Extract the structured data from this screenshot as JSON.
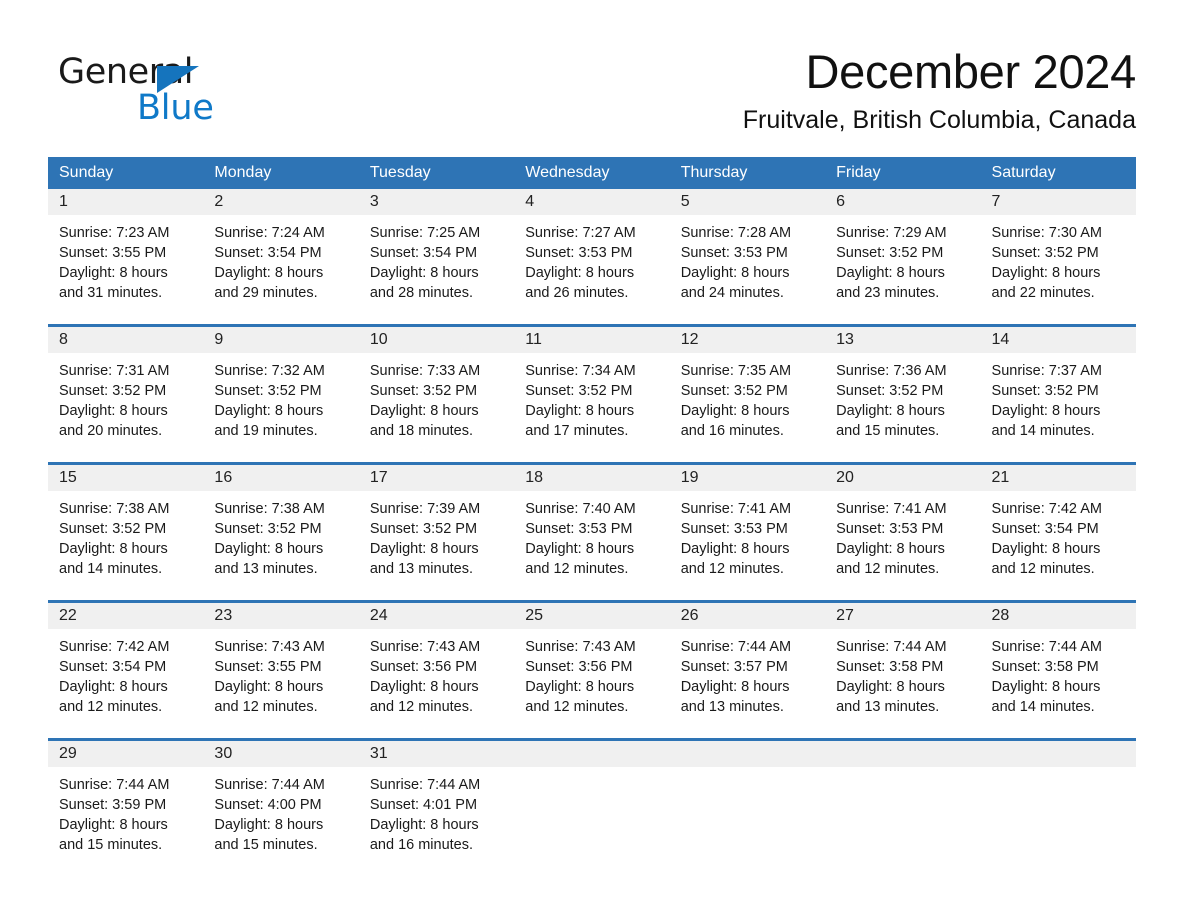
{
  "brand": {
    "name_part1": "General",
    "name_part2": "Blue",
    "logo_icon": "triangle-flag-icon",
    "accent_color": "#0f79c8"
  },
  "header": {
    "month_title": "December 2024",
    "location": "Fruitvale, British Columbia, Canada"
  },
  "theme": {
    "header_blue": "#2e74b5",
    "daynum_band": "#f0f0f0",
    "text": "#1a1a1a"
  },
  "weekdays": [
    "Sunday",
    "Monday",
    "Tuesday",
    "Wednesday",
    "Thursday",
    "Friday",
    "Saturday"
  ],
  "weeks": [
    [
      {
        "day": "1",
        "sunrise": "Sunrise: 7:23 AM",
        "sunset": "Sunset: 3:55 PM",
        "daylight_1": "Daylight: 8 hours",
        "daylight_2": "and 31 minutes."
      },
      {
        "day": "2",
        "sunrise": "Sunrise: 7:24 AM",
        "sunset": "Sunset: 3:54 PM",
        "daylight_1": "Daylight: 8 hours",
        "daylight_2": "and 29 minutes."
      },
      {
        "day": "3",
        "sunrise": "Sunrise: 7:25 AM",
        "sunset": "Sunset: 3:54 PM",
        "daylight_1": "Daylight: 8 hours",
        "daylight_2": "and 28 minutes."
      },
      {
        "day": "4",
        "sunrise": "Sunrise: 7:27 AM",
        "sunset": "Sunset: 3:53 PM",
        "daylight_1": "Daylight: 8 hours",
        "daylight_2": "and 26 minutes."
      },
      {
        "day": "5",
        "sunrise": "Sunrise: 7:28 AM",
        "sunset": "Sunset: 3:53 PM",
        "daylight_1": "Daylight: 8 hours",
        "daylight_2": "and 24 minutes."
      },
      {
        "day": "6",
        "sunrise": "Sunrise: 7:29 AM",
        "sunset": "Sunset: 3:52 PM",
        "daylight_1": "Daylight: 8 hours",
        "daylight_2": "and 23 minutes."
      },
      {
        "day": "7",
        "sunrise": "Sunrise: 7:30 AM",
        "sunset": "Sunset: 3:52 PM",
        "daylight_1": "Daylight: 8 hours",
        "daylight_2": "and 22 minutes."
      }
    ],
    [
      {
        "day": "8",
        "sunrise": "Sunrise: 7:31 AM",
        "sunset": "Sunset: 3:52 PM",
        "daylight_1": "Daylight: 8 hours",
        "daylight_2": "and 20 minutes."
      },
      {
        "day": "9",
        "sunrise": "Sunrise: 7:32 AM",
        "sunset": "Sunset: 3:52 PM",
        "daylight_1": "Daylight: 8 hours",
        "daylight_2": "and 19 minutes."
      },
      {
        "day": "10",
        "sunrise": "Sunrise: 7:33 AM",
        "sunset": "Sunset: 3:52 PM",
        "daylight_1": "Daylight: 8 hours",
        "daylight_2": "and 18 minutes."
      },
      {
        "day": "11",
        "sunrise": "Sunrise: 7:34 AM",
        "sunset": "Sunset: 3:52 PM",
        "daylight_1": "Daylight: 8 hours",
        "daylight_2": "and 17 minutes."
      },
      {
        "day": "12",
        "sunrise": "Sunrise: 7:35 AM",
        "sunset": "Sunset: 3:52 PM",
        "daylight_1": "Daylight: 8 hours",
        "daylight_2": "and 16 minutes."
      },
      {
        "day": "13",
        "sunrise": "Sunrise: 7:36 AM",
        "sunset": "Sunset: 3:52 PM",
        "daylight_1": "Daylight: 8 hours",
        "daylight_2": "and 15 minutes."
      },
      {
        "day": "14",
        "sunrise": "Sunrise: 7:37 AM",
        "sunset": "Sunset: 3:52 PM",
        "daylight_1": "Daylight: 8 hours",
        "daylight_2": "and 14 minutes."
      }
    ],
    [
      {
        "day": "15",
        "sunrise": "Sunrise: 7:38 AM",
        "sunset": "Sunset: 3:52 PM",
        "daylight_1": "Daylight: 8 hours",
        "daylight_2": "and 14 minutes."
      },
      {
        "day": "16",
        "sunrise": "Sunrise: 7:38 AM",
        "sunset": "Sunset: 3:52 PM",
        "daylight_1": "Daylight: 8 hours",
        "daylight_2": "and 13 minutes."
      },
      {
        "day": "17",
        "sunrise": "Sunrise: 7:39 AM",
        "sunset": "Sunset: 3:52 PM",
        "daylight_1": "Daylight: 8 hours",
        "daylight_2": "and 13 minutes."
      },
      {
        "day": "18",
        "sunrise": "Sunrise: 7:40 AM",
        "sunset": "Sunset: 3:53 PM",
        "daylight_1": "Daylight: 8 hours",
        "daylight_2": "and 12 minutes."
      },
      {
        "day": "19",
        "sunrise": "Sunrise: 7:41 AM",
        "sunset": "Sunset: 3:53 PM",
        "daylight_1": "Daylight: 8 hours",
        "daylight_2": "and 12 minutes."
      },
      {
        "day": "20",
        "sunrise": "Sunrise: 7:41 AM",
        "sunset": "Sunset: 3:53 PM",
        "daylight_1": "Daylight: 8 hours",
        "daylight_2": "and 12 minutes."
      },
      {
        "day": "21",
        "sunrise": "Sunrise: 7:42 AM",
        "sunset": "Sunset: 3:54 PM",
        "daylight_1": "Daylight: 8 hours",
        "daylight_2": "and 12 minutes."
      }
    ],
    [
      {
        "day": "22",
        "sunrise": "Sunrise: 7:42 AM",
        "sunset": "Sunset: 3:54 PM",
        "daylight_1": "Daylight: 8 hours",
        "daylight_2": "and 12 minutes."
      },
      {
        "day": "23",
        "sunrise": "Sunrise: 7:43 AM",
        "sunset": "Sunset: 3:55 PM",
        "daylight_1": "Daylight: 8 hours",
        "daylight_2": "and 12 minutes."
      },
      {
        "day": "24",
        "sunrise": "Sunrise: 7:43 AM",
        "sunset": "Sunset: 3:56 PM",
        "daylight_1": "Daylight: 8 hours",
        "daylight_2": "and 12 minutes."
      },
      {
        "day": "25",
        "sunrise": "Sunrise: 7:43 AM",
        "sunset": "Sunset: 3:56 PM",
        "daylight_1": "Daylight: 8 hours",
        "daylight_2": "and 12 minutes."
      },
      {
        "day": "26",
        "sunrise": "Sunrise: 7:44 AM",
        "sunset": "Sunset: 3:57 PM",
        "daylight_1": "Daylight: 8 hours",
        "daylight_2": "and 13 minutes."
      },
      {
        "day": "27",
        "sunrise": "Sunrise: 7:44 AM",
        "sunset": "Sunset: 3:58 PM",
        "daylight_1": "Daylight: 8 hours",
        "daylight_2": "and 13 minutes."
      },
      {
        "day": "28",
        "sunrise": "Sunrise: 7:44 AM",
        "sunset": "Sunset: 3:58 PM",
        "daylight_1": "Daylight: 8 hours",
        "daylight_2": "and 14 minutes."
      }
    ],
    [
      {
        "day": "29",
        "sunrise": "Sunrise: 7:44 AM",
        "sunset": "Sunset: 3:59 PM",
        "daylight_1": "Daylight: 8 hours",
        "daylight_2": "and 15 minutes."
      },
      {
        "day": "30",
        "sunrise": "Sunrise: 7:44 AM",
        "sunset": "Sunset: 4:00 PM",
        "daylight_1": "Daylight: 8 hours",
        "daylight_2": "and 15 minutes."
      },
      {
        "day": "31",
        "sunrise": "Sunrise: 7:44 AM",
        "sunset": "Sunset: 4:01 PM",
        "daylight_1": "Daylight: 8 hours",
        "daylight_2": "and 16 minutes."
      },
      {
        "day": "",
        "sunrise": "",
        "sunset": "",
        "daylight_1": "",
        "daylight_2": ""
      },
      {
        "day": "",
        "sunrise": "",
        "sunset": "",
        "daylight_1": "",
        "daylight_2": ""
      },
      {
        "day": "",
        "sunrise": "",
        "sunset": "",
        "daylight_1": "",
        "daylight_2": ""
      },
      {
        "day": "",
        "sunrise": "",
        "sunset": "",
        "daylight_1": "",
        "daylight_2": ""
      }
    ]
  ]
}
